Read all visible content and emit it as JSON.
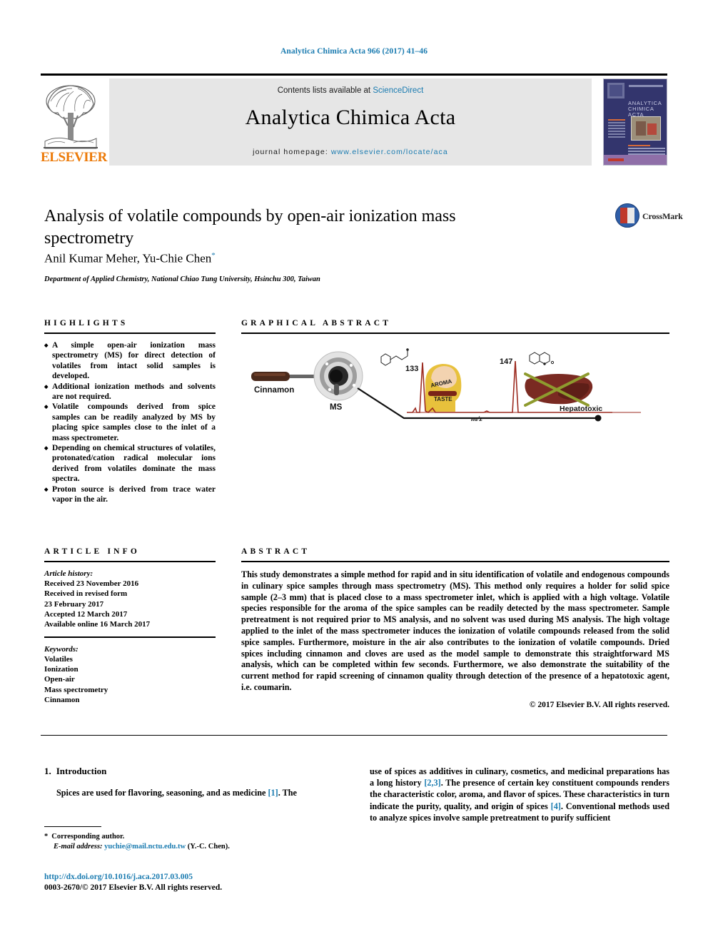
{
  "running_head": "Analytica Chimica Acta 966 (2017) 41–46",
  "journal_header": {
    "publisher": "ELSEVIER",
    "contents_prefix": "Contents lists available at ",
    "contents_link": "ScienceDirect",
    "journal_name": "Analytica Chimica Acta",
    "homepage_prefix": "journal homepage: ",
    "homepage_url": "www.elsevier.com/locate/aca",
    "cover_title": "ANALYTICA CHIMICA ACTA"
  },
  "article": {
    "title": "Analysis of volatile compounds by open-air ionization mass spectrometry",
    "authors": "Anil Kumar Meher, Yu-Chie Chen",
    "corresponding_marker": "*",
    "affiliation": "Department of Applied Chemistry, National Chiao Tung University, Hsinchu 300, Taiwan",
    "crossmark_label": "CrossMark"
  },
  "highlights": {
    "heading": "HIGHLIGHTS",
    "items": [
      "A simple open-air ionization mass spectrometry (MS) for direct detection of volatiles from intact solid samples is developed.",
      "Additional ionization methods and solvents are not required.",
      "Volatile compounds derived from spice samples can be readily analyzed by MS by placing spice samples close to the inlet of a mass spectrometer.",
      "Depending on chemical structures of volatiles, protonated/cation radical molecular ions derived from volatiles dominate the mass spectra.",
      "Proton source is derived from trace water vapor in the air."
    ]
  },
  "graphical_abstract": {
    "heading": "GRAPHICAL ABSTRACT",
    "labels": {
      "sample": "Cinnamon",
      "instrument": "MS",
      "peak_1": "133",
      "peak_2": "147",
      "axis": "m/z",
      "aroma": "AROMA",
      "taste": "TASTE",
      "toxicity": "Hepatotoxic"
    }
  },
  "article_info": {
    "heading": "ARTICLE INFO",
    "history_label": "Article history:",
    "history": [
      "Received 23 November 2016",
      "Received in revised form",
      "23 February 2017",
      "Accepted 12 March 2017",
      "Available online 16 March 2017"
    ],
    "keywords_label": "Keywords:",
    "keywords": [
      "Volatiles",
      "Ionization",
      "Open-air",
      "Mass spectrometry",
      "Cinnamon"
    ]
  },
  "abstract": {
    "heading": "ABSTRACT",
    "text": "This study demonstrates a simple method for rapid and in situ identification of volatile and endogenous compounds in culinary spice samples through mass spectrometry (MS). This method only requires a holder for solid spice sample (2–3 mm) that is placed close to a mass spectrometer inlet, which is applied with a high voltage. Volatile species responsible for the aroma of the spice samples can be readily detected by the mass spectrometer. Sample pretreatment is not required prior to MS analysis, and no solvent was used during MS analysis. The high voltage applied to the inlet of the mass spectrometer induces the ionization of volatile compounds released from the solid spice samples. Furthermore, moisture in the air also contributes to the ionization of volatile compounds. Dried spices including cinnamon and cloves are used as the model sample to demonstrate this straightforward MS analysis, which can be completed within few seconds. Furthermore, we also demonstrate the suitability of the current method for rapid screening of cinnamon quality through detection of the presence of a hepatotoxic agent, i.e. coumarin.",
    "copyright": "© 2017 Elsevier B.V. All rights reserved."
  },
  "body": {
    "section_number": "1.",
    "section_title": "Introduction",
    "left_paragraph_a": "Spices are used for flavoring, seasoning, and as medicine ",
    "left_ref_1": "[1]",
    "left_paragraph_b": ". The",
    "right_paragraph_a": "use of spices as additives in culinary, cosmetics, and medicinal preparations has a long history ",
    "right_ref_1": "[2,3]",
    "right_paragraph_b": ". The presence of certain key constituent compounds renders the characteristic color, aroma, and flavor of spices. These characteristics in turn indicate the purity, quality, and origin of spices ",
    "right_ref_2": "[4]",
    "right_paragraph_c": ". Conventional methods used to analyze spices involve sample pretreatment to purify sufficient"
  },
  "footnote": {
    "marker": "*",
    "corresponding": "Corresponding author.",
    "email_label": "E-mail address:",
    "email": "yuchie@mail.nctu.edu.tw",
    "email_suffix": "(Y.-C. Chen)."
  },
  "footer": {
    "doi": "http://dx.doi.org/10.1016/j.aca.2017.03.005",
    "issn_line": "0003-2670/© 2017 Elsevier B.V. All rights reserved."
  },
  "colors": {
    "link": "#1a7bb0",
    "elsevier_orange": "#ec7a08",
    "header_band": "#e6e6e6"
  }
}
